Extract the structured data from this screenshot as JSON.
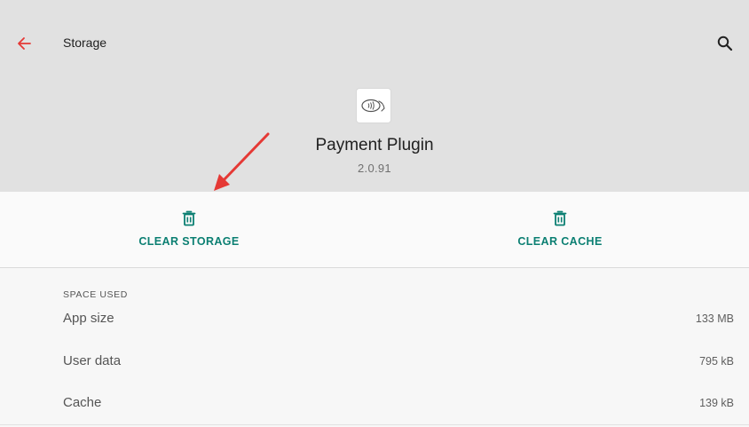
{
  "header": {
    "title": "Storage",
    "back_icon": "arrow-left-icon",
    "search_icon": "search-icon",
    "accent_color": "#e53935"
  },
  "app": {
    "name": "Payment Plugin",
    "version": "2.0.91",
    "icon": "contactless-payment-icon"
  },
  "actions": {
    "clear_storage": "CLEAR STORAGE",
    "clear_cache": "CLEAR CACHE",
    "icon": "trash-icon",
    "color": "#0b7f72"
  },
  "storage": {
    "section_label": "SPACE USED",
    "rows": [
      {
        "label": "App size",
        "value": "133 MB"
      },
      {
        "label": "User data",
        "value": "795 kB"
      },
      {
        "label": "Cache",
        "value": "139 kB"
      }
    ]
  },
  "annotation": {
    "arrow_color": "#e53935",
    "target": "clear-storage-button"
  }
}
